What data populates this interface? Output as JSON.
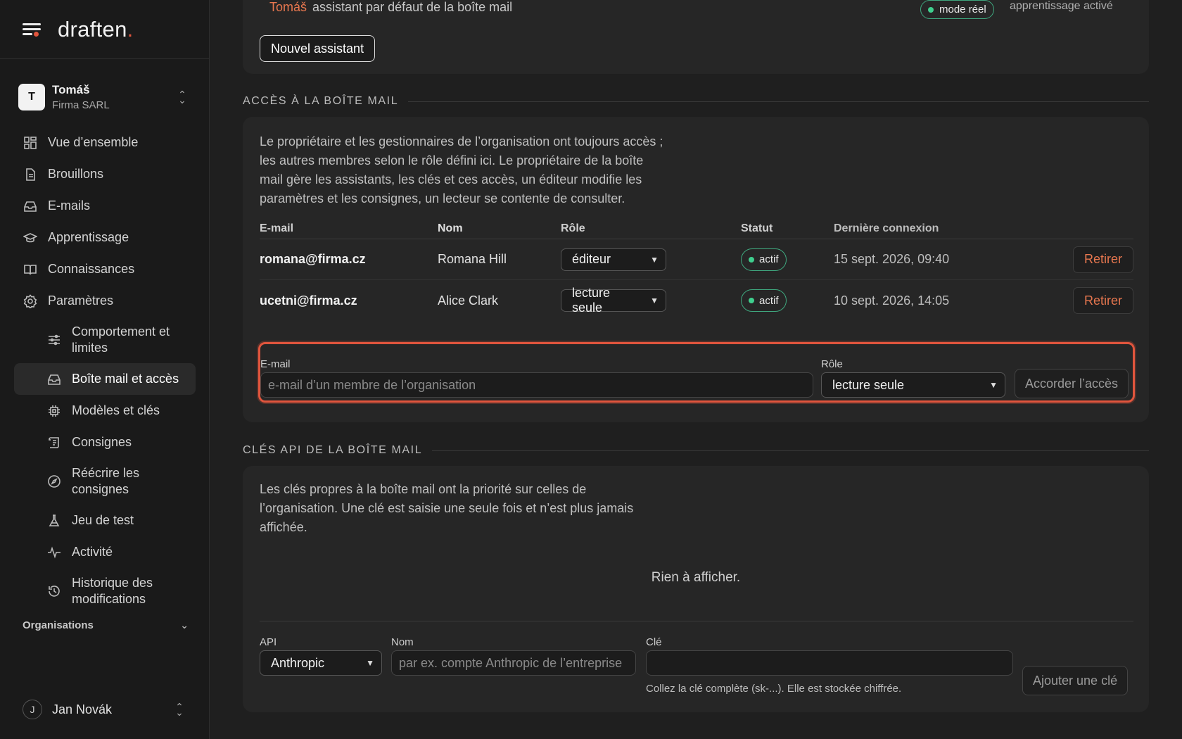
{
  "brand": {
    "name": "draften",
    "dot": "."
  },
  "org": {
    "initial": "T",
    "name": "Tomáš",
    "sub": "Firma SARL"
  },
  "nav": {
    "overview": "Vue d’ensemble",
    "drafts": "Brouillons",
    "emails": "E-mails",
    "learning": "Apprentissage",
    "knowledge": "Connaissances",
    "settings": "Paramètres",
    "behavior": "Comportement et limites",
    "mailbox_access": "Boîte mail et accès",
    "models_keys": "Modèles et clés",
    "instructions": "Consignes",
    "rewrite": "Réécrire les consignes",
    "testset": "Jeu de test",
    "activity": "Activité",
    "history": "Historique des modifications"
  },
  "organizations": {
    "label": "Organisations"
  },
  "user": {
    "initial": "J",
    "name": "Jan Novák"
  },
  "assistant": {
    "name": "Tomáš",
    "text": "assistant par défaut de la boîte mail",
    "mode": "mode réel",
    "learning": "apprentissage activé",
    "new_button": "Nouvel assistant"
  },
  "access": {
    "title": "ACCÈS À LA BOÎTE MAIL",
    "desc": [
      "Le propriétaire et les gestionnaires de l’organisation ont toujours accès ;",
      "les autres membres selon le rôle défini ici. Le propriétaire de la boîte",
      "mail gère les assistants, les clés et ces accès, un éditeur modifie les",
      "paramètres et les consignes, un lecteur se contente de consulter."
    ],
    "columns": {
      "email": "E-mail",
      "name": "Nom",
      "role": "Rôle",
      "status": "Statut",
      "last": "Dernière connexion"
    },
    "rows": [
      {
        "email": "romana@firma.cz",
        "name": "Romana Hill",
        "role": "éditeur",
        "status": "actif",
        "last": "15 sept. 2026, 09:40",
        "action": "Retirer"
      },
      {
        "email": "ucetni@firma.cz",
        "name": "Alice Clark",
        "role": "lecture seule",
        "status": "actif",
        "last": "10 sept. 2026, 14:05",
        "action": "Retirer"
      }
    ],
    "grant": {
      "email_label": "E-mail",
      "email_placeholder": "e-mail d’un membre de l’organisation",
      "role_label": "Rôle",
      "role_value": "lecture seule",
      "button": "Accorder l’accès"
    }
  },
  "keys": {
    "title": "CLÉS API DE LA BOÎTE MAIL",
    "desc": [
      "Les clés propres à la boîte mail ont la priorité sur celles de",
      "l’organisation. Une clé est saisie une seule fois et n’est plus jamais",
      "affichée."
    ],
    "empty": "Rien à afficher.",
    "api_label": "API",
    "api_value": "Anthropic",
    "name_label": "Nom",
    "name_placeholder": "par ex. compte Anthropic de l’entreprise",
    "key_label": "Clé",
    "key_hint": "Collez la clé complète (sk-...). Elle est stockée chiffrée.",
    "add_button": "Ajouter une clé"
  },
  "colors": {
    "accent": "#e0553d",
    "active_green": "#3fcf8e",
    "danger_text": "#e8774f"
  }
}
